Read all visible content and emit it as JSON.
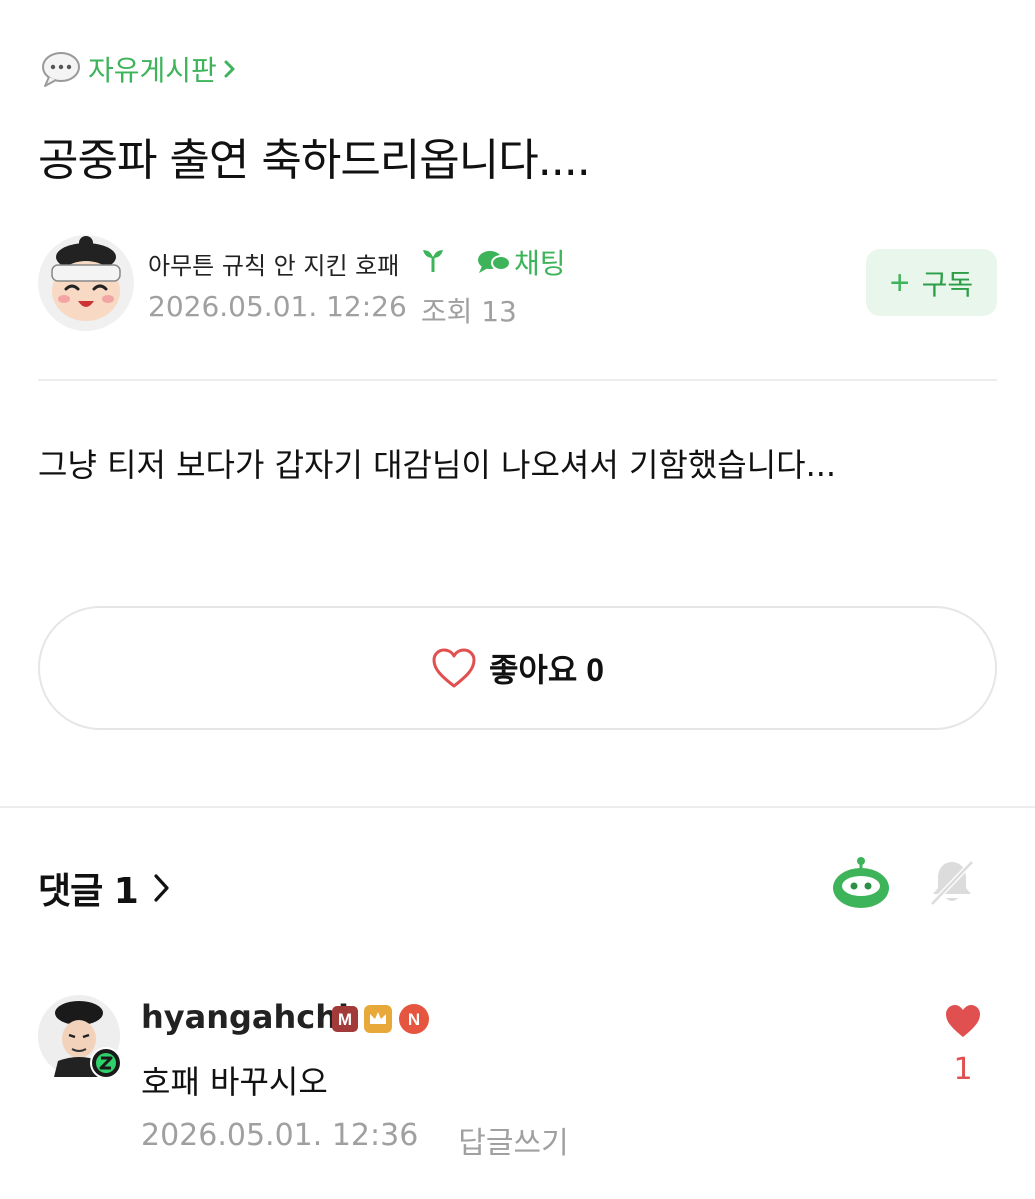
{
  "board": {
    "name": "자유게시판"
  },
  "post": {
    "title": "공중파 출연 축하드리옵니다....",
    "author": "아무튼 규칙 안 지킨 호패",
    "chat_label": "채팅",
    "date": "2026.05.01. 12:26",
    "views": "조회 13",
    "subscribe_label": "구독",
    "body": "그냥 티저 보다가 갑자기 대감님이 나오셔서 기함했습니다..."
  },
  "like": {
    "label": "좋아요 0"
  },
  "comments": {
    "header": "댓글 1",
    "items": [
      {
        "author": "hyangahchi",
        "badges": [
          "M",
          "crown",
          "N"
        ],
        "text": "호패 바꾸시오",
        "date": "2026.05.01. 12:36",
        "reply_label": "답글쓰기",
        "like_count": "1"
      }
    ]
  },
  "colors": {
    "accent_green": "#3db35a",
    "subscribe_bg": "#e8f6eb",
    "meta_gray": "#a0a0a0",
    "heart_red": "#e05050",
    "badge_m": "#a33a3a",
    "badge_crown": "#e9a83a",
    "badge_n": "#e5553f"
  },
  "icons": {
    "board": "speech-bubble-icon",
    "sprout": "sprout-icon",
    "chat": "chat-bubbles-icon",
    "like": "heart-outline-icon",
    "robot": "robot-icon",
    "bell": "bell-off-icon",
    "comment_like": "heart-filled-icon"
  }
}
